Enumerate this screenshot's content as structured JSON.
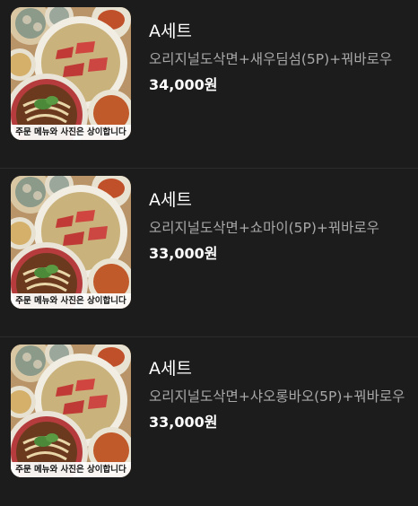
{
  "menu": {
    "items": [
      {
        "name": "A세트",
        "description": "오리지널도삭면+새우딤섬(5P)+꿔바로우",
        "price": "34,000원",
        "image_caption": "주문 메뉴와 사진은 상이합니다"
      },
      {
        "name": "A세트",
        "description": "오리지널도삭면+쇼마이(5P)+꿔바로우",
        "price": "33,000원",
        "image_caption": "주문 메뉴와 사진은 상이합니다"
      },
      {
        "name": "A세트",
        "description": "오리지널도삭면+샤오롱바오(5P)+꿔바로우",
        "price": "33,000원",
        "image_caption": "주문 메뉴와 사진은 상이합니다"
      }
    ]
  },
  "colors": {
    "background": "#1c1c1c",
    "divider": "#2c2c2c",
    "title_text": "#ffffff",
    "description_text": "#a8a8a8",
    "price_text": "#ffffff"
  }
}
